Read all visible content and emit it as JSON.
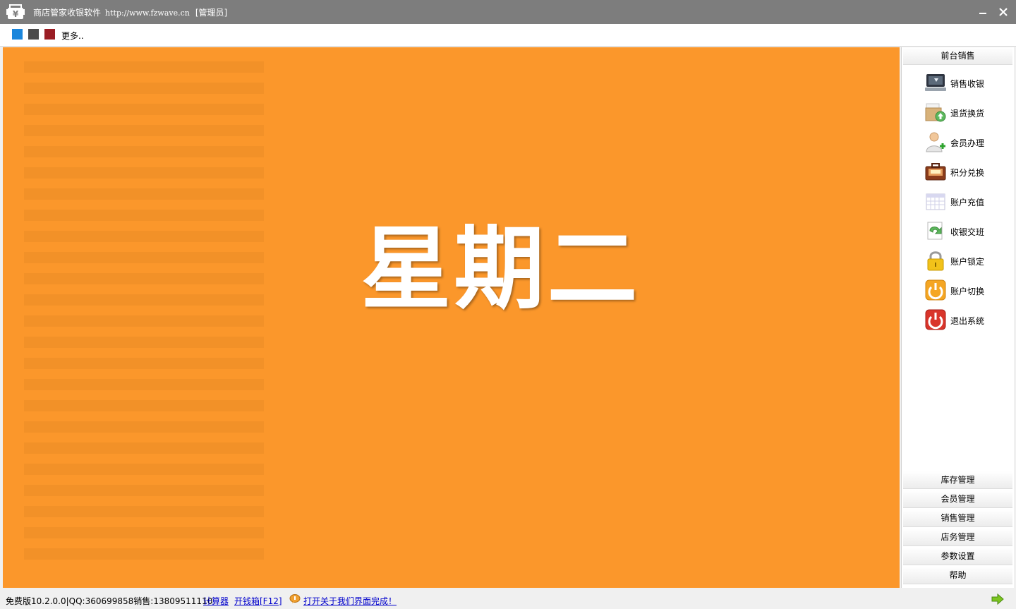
{
  "window": {
    "app_name": "商店管家收银软件",
    "url": "http://www.fzwave.cn",
    "role": "[管理员]"
  },
  "toolbar": {
    "swatch_colors": [
      "#1a86dc",
      "#4b4b4b",
      "#9a1d24"
    ],
    "more_label": "更多.."
  },
  "main": {
    "background_color": "#fb972b",
    "weekday": "星期二"
  },
  "sidebar": {
    "active_group": "前台销售",
    "items": [
      {
        "label": "销售收银",
        "icon": "cash-register-icon"
      },
      {
        "label": "退货换货",
        "icon": "return-box-icon"
      },
      {
        "label": "会员办理",
        "icon": "add-user-icon"
      },
      {
        "label": "积分兑换",
        "icon": "points-briefcase-icon"
      },
      {
        "label": "账户充值",
        "icon": "calendar-grid-icon"
      },
      {
        "label": "收银交班",
        "icon": "shift-exchange-icon"
      },
      {
        "label": "账户锁定",
        "icon": "lock-icon"
      },
      {
        "label": "账户切换",
        "icon": "switch-power-icon"
      },
      {
        "label": "退出系统",
        "icon": "power-exit-icon"
      }
    ],
    "groups": [
      "库存管理",
      "会员管理",
      "销售管理",
      "店务管理",
      "参数设置",
      "帮助"
    ]
  },
  "status": {
    "version_text": "免费版10.2.0.0|QQ:360699858销售:13809511110",
    "calculator_link": "计算器",
    "cash_drawer_link": "开钱箱[F12]",
    "about_link": "打开关于我们界面完成！"
  }
}
